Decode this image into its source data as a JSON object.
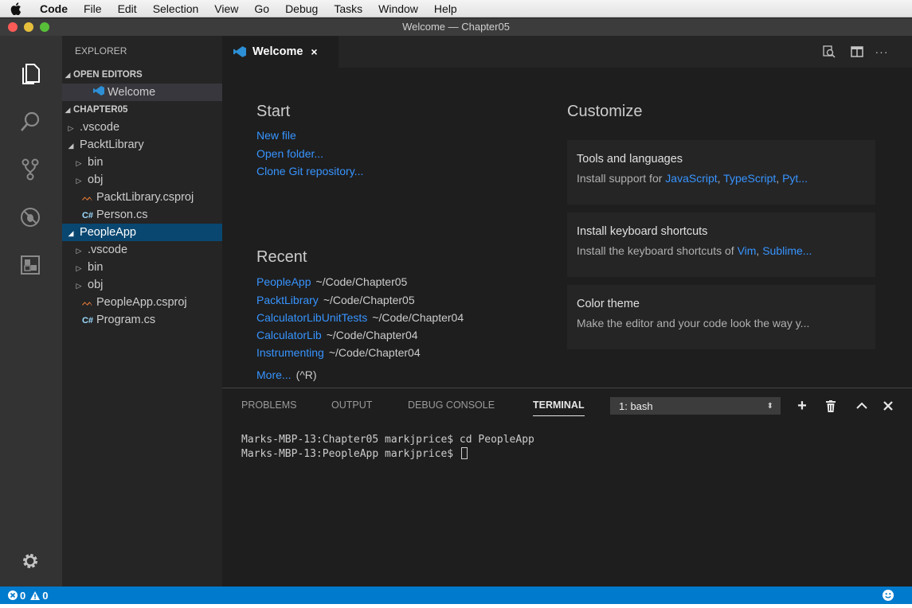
{
  "menubar": {
    "app": "Code",
    "items": [
      "File",
      "Edit",
      "Selection",
      "View",
      "Go",
      "Debug",
      "Tasks",
      "Window",
      "Help"
    ]
  },
  "window": {
    "title": "Welcome — Chapter05"
  },
  "sidebar": {
    "title": "EXPLORER",
    "open_editors": {
      "label": "OPEN EDITORS",
      "items": [
        {
          "label": "Welcome",
          "icon": "vscode-icon"
        }
      ]
    },
    "folder": {
      "label": "CHAPTER05",
      "tree": [
        {
          "label": ".vscode",
          "type": "folder",
          "expanded": false
        },
        {
          "label": "PacktLibrary",
          "type": "folder",
          "expanded": true
        },
        {
          "label": "bin",
          "type": "folder",
          "expanded": false
        },
        {
          "label": "obj",
          "type": "folder",
          "expanded": false
        },
        {
          "label": "PacktLibrary.csproj",
          "type": "csproj"
        },
        {
          "label": "Person.cs",
          "type": "cs"
        },
        {
          "label": "PeopleApp",
          "type": "folder",
          "expanded": true,
          "selected": true
        },
        {
          "label": ".vscode",
          "type": "folder",
          "expanded": false
        },
        {
          "label": "bin",
          "type": "folder",
          "expanded": false
        },
        {
          "label": "obj",
          "type": "folder",
          "expanded": false
        },
        {
          "label": "PeopleApp.csproj",
          "type": "csproj"
        },
        {
          "label": "Program.cs",
          "type": "cs"
        }
      ]
    }
  },
  "editor": {
    "tab": {
      "label": "Welcome",
      "close": "×"
    }
  },
  "welcome": {
    "start": {
      "heading": "Start",
      "links": [
        "New file",
        "Open folder...",
        "Clone Git repository..."
      ]
    },
    "recent": {
      "heading": "Recent",
      "items": [
        {
          "name": "PeopleApp",
          "path": "~/Code/Chapter05"
        },
        {
          "name": "PacktLibrary",
          "path": "~/Code/Chapter05"
        },
        {
          "name": "CalculatorLibUnitTests",
          "path": "~/Code/Chapter04"
        },
        {
          "name": "CalculatorLib",
          "path": "~/Code/Chapter04"
        },
        {
          "name": "Instrumenting",
          "path": "~/Code/Chapter04"
        }
      ],
      "more": "More...",
      "more_shortcut": "(^R)"
    },
    "customize": {
      "heading": "Customize",
      "cards": [
        {
          "title": "Tools and languages",
          "desc_prefix": "Install support for ",
          "links": [
            "JavaScript",
            "TypeScript",
            "Pyt..."
          ]
        },
        {
          "title": "Install keyboard shortcuts",
          "desc_prefix": "Install the keyboard shortcuts of ",
          "links": [
            "Vim",
            "Sublime..."
          ]
        },
        {
          "title": "Color theme",
          "desc_prefix": "Make the editor and your code look the way y...",
          "links": []
        }
      ]
    }
  },
  "panel": {
    "tabs": [
      "PROBLEMS",
      "OUTPUT",
      "DEBUG CONSOLE",
      "TERMINAL"
    ],
    "active_tab": "TERMINAL",
    "terminal_select": "1: bash",
    "terminal_lines": [
      "Marks-MBP-13:Chapter05 markjprice$ cd PeopleApp",
      "Marks-MBP-13:PeopleApp markjprice$ "
    ]
  },
  "statusbar": {
    "errors": "0",
    "warnings": "0"
  },
  "colors": {
    "accent": "#007acc",
    "link": "#3794ff",
    "selection": "#094771"
  }
}
